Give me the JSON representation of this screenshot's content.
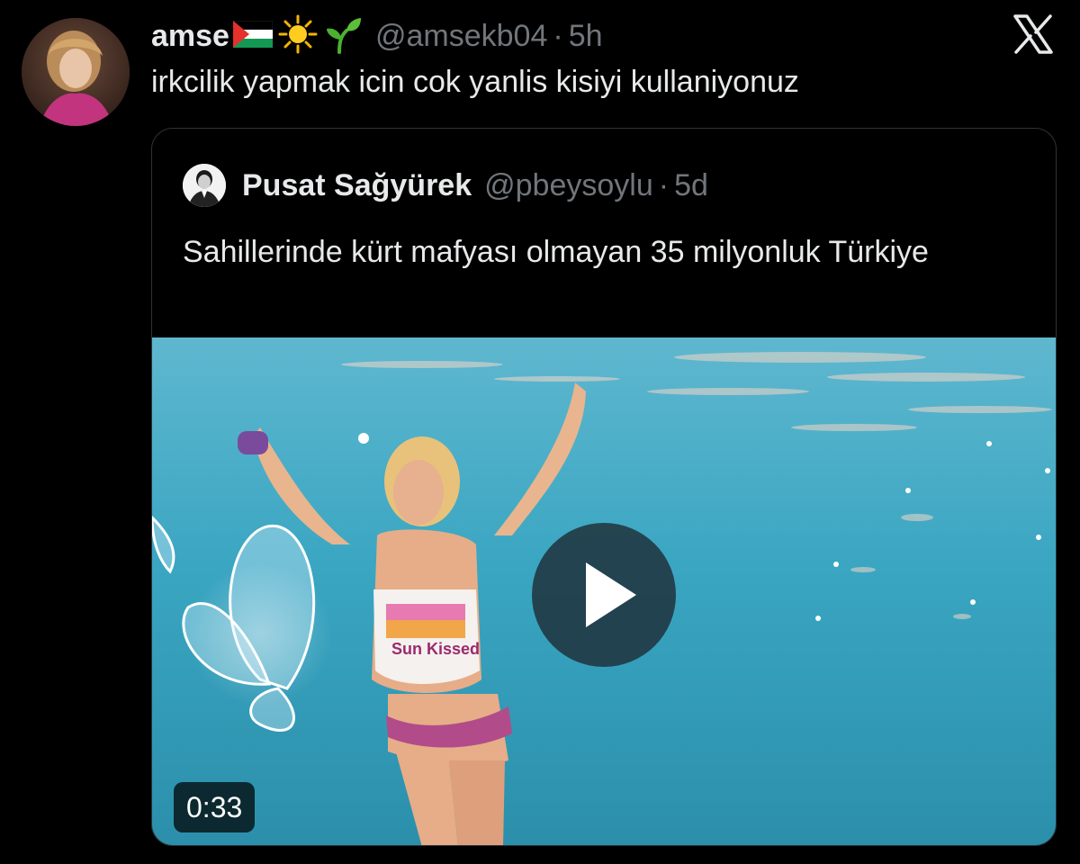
{
  "tweet": {
    "author_name": "amse",
    "emoji_icons": [
      "palestine-flag-icon",
      "sun-icon",
      "seedling-icon"
    ],
    "handle": "@amsekb04",
    "separator": "·",
    "time": "5h",
    "text": "irkcilik yapmak icin cok yanlis kisiyi kullaniyonuz"
  },
  "brand_icon": "x-logo-icon",
  "quoted_tweet": {
    "author_name": "Pusat Sağyürek",
    "handle": "@pbeysoylu",
    "separator": "·",
    "time": "5d",
    "text": "Sahillerinde kürt mafyası olmayan 35 milyonluk Türkiye",
    "media": {
      "type": "video",
      "duration": "0:33",
      "overlay_text": "Sun Kissed",
      "play_icon": "play-icon"
    }
  },
  "colors": {
    "background": "#000000",
    "primary_text": "#e7e9ea",
    "secondary_text": "#71767b",
    "border": "#2f3336",
    "water": "#3ca9c4"
  }
}
